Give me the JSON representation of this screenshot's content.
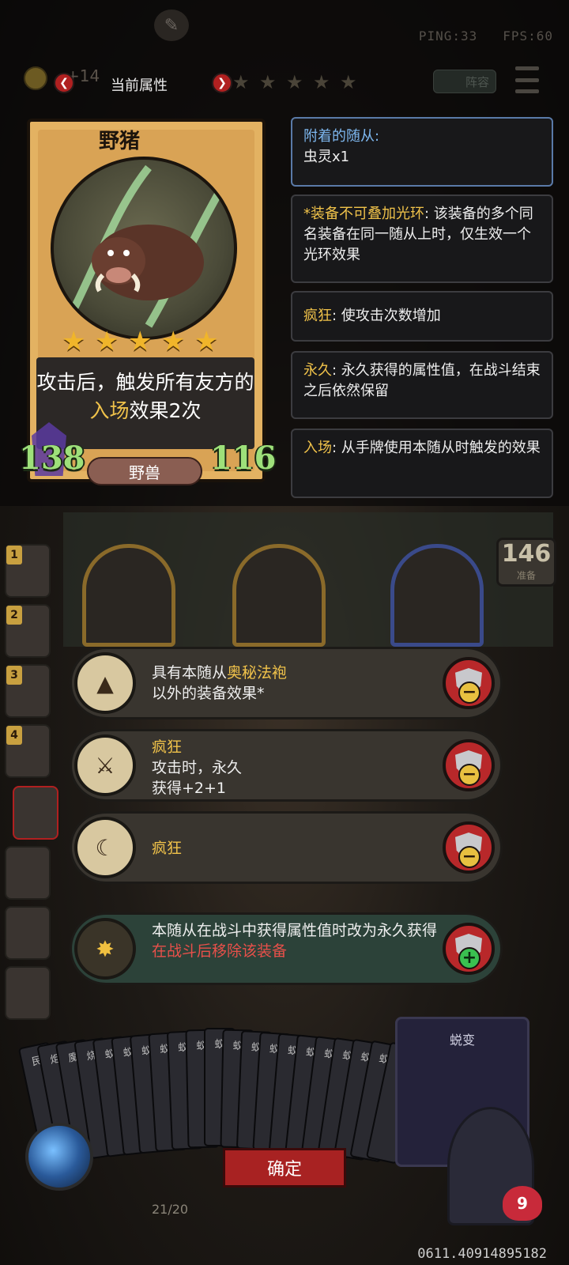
{
  "topbar": {
    "ping": "PING:33",
    "fps": "FPS:60",
    "coin_value": "+14",
    "attr_title": "当前属性",
    "stars": 5,
    "team_label": "阵容"
  },
  "card": {
    "name": "野猪",
    "stars": 5,
    "description_pre": "攻击后，触发所有友方的",
    "description_keyword": "入场",
    "description_post": "效果2次",
    "attack": "138",
    "health": "116",
    "tribe": "野兽"
  },
  "keyword_panels": [
    {
      "head": "附着的随从:",
      "body": "虫灵x1"
    },
    {
      "head": "*装备不可叠加光环",
      "body": ": 该装备的多个同名装备在同一随从上时，仅生效一个光环效果"
    },
    {
      "head": "疯狂",
      "body": ": 使攻击次数增加"
    },
    {
      "head": "永久",
      "body": ": 永久获得的属性值，在战斗结束之后依然保留"
    },
    {
      "head": "入场",
      "body": ": 从手牌使用本随从时触发的效果"
    }
  ],
  "board": {
    "slot_numbers": [
      "1",
      "2",
      "3",
      "4"
    ],
    "deck_number": "146",
    "deck_label": "准备"
  },
  "equipment": [
    {
      "line1_pre": "具有本随从",
      "line1_kw": "奥秘法袍",
      "line2": "以外的装备效果*",
      "action": "remove"
    },
    {
      "line1": "疯狂",
      "line2": "攻击时，永久",
      "line3": "获得+2+1",
      "action": "remove"
    },
    {
      "line1": "疯狂",
      "action": "remove"
    },
    {
      "line1": "本随从在战斗中获得属性值时改为永久获得",
      "line2_red": "在战斗后移除该装备",
      "action": "add"
    }
  ],
  "hand": {
    "card_labels": [
      "民",
      "炬",
      "魔",
      "烧",
      "蚁",
      "蚁",
      "蚁",
      "蚁",
      "蚁",
      "蚁",
      "蚁",
      "蚁",
      "蚁",
      "蚁",
      "蚁",
      "蚁",
      "蚁",
      "蚁",
      "蚁",
      "蚁",
      "蚁"
    ],
    "featured_card": "蜕变",
    "confirm_label": "确定",
    "deck_count": "21/20",
    "hero_health": "9"
  },
  "footer": {
    "id_code": "0611.40914895182"
  }
}
